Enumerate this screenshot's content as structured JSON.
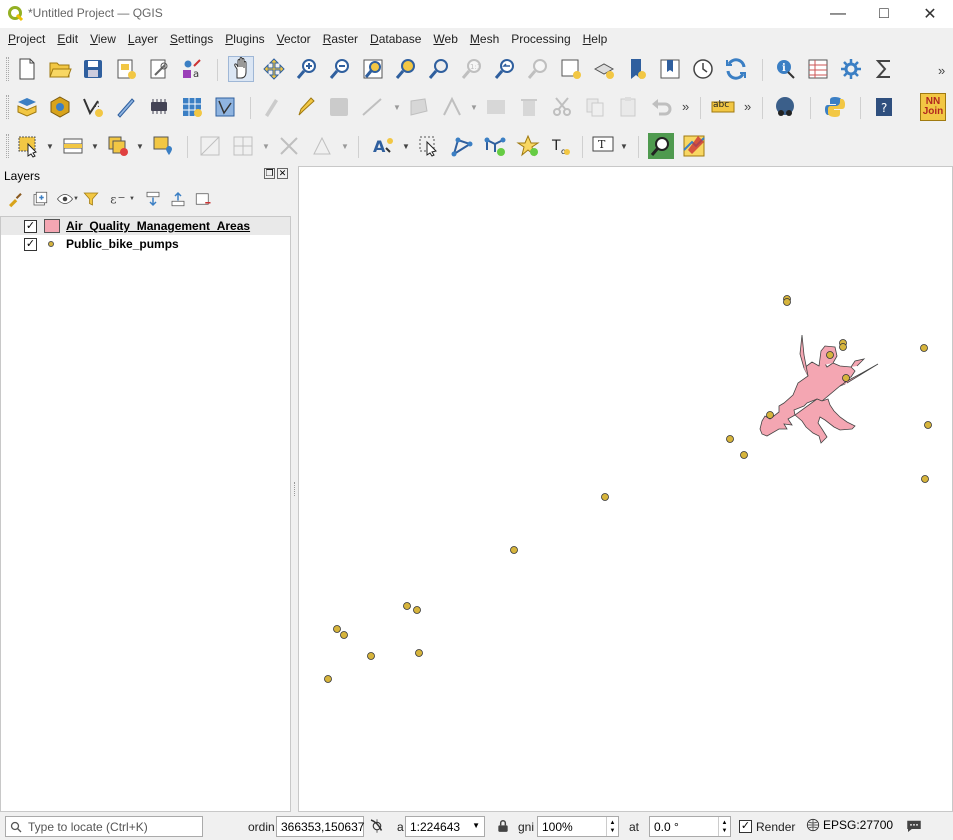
{
  "window": {
    "title": "*Untitled Project — QGIS"
  },
  "menu": [
    {
      "label": "Project",
      "key": "P",
      "rest": "roject"
    },
    {
      "label": "Edit",
      "key": "E",
      "rest": "dit"
    },
    {
      "label": "View",
      "key": "V",
      "rest": "iew"
    },
    {
      "label": "Layer",
      "key": "L",
      "rest": "ayer"
    },
    {
      "label": "Settings",
      "key": "S",
      "rest": "ettings"
    },
    {
      "label": "Plugins",
      "key": "P",
      "rest": "lugins"
    },
    {
      "label": "Vector",
      "key": "V",
      "rest": "ector"
    },
    {
      "label": "Raster",
      "key": "R",
      "rest": "aster"
    },
    {
      "label": "Database",
      "key": "D",
      "rest": "atabase"
    },
    {
      "label": "Web",
      "key": "W",
      "rest": "eb"
    },
    {
      "label": "Mesh",
      "key": "M",
      "rest": "esh"
    },
    {
      "label": "Processing",
      "key": "",
      "rest": "Processing"
    },
    {
      "label": "Help",
      "key": "H",
      "rest": "elp"
    }
  ],
  "toolbar": {
    "nn_join_line1": "NN",
    "nn_join_line2": "Join",
    "abc": "abc",
    "overflow": "»"
  },
  "layers_panel": {
    "title": "Layers",
    "layers": [
      {
        "name": "Air_Quality_Management_Areas",
        "checked": "✓",
        "type": "polygon",
        "color": "#f4a6b2"
      },
      {
        "name": "Public_bike_pumps",
        "checked": "✓",
        "type": "point",
        "color": "#d6b43c"
      }
    ]
  },
  "status": {
    "locate_placeholder": "Type to locate (Ctrl+K)",
    "coord_label": "ordin",
    "coordinate": "366353,150637",
    "scale_label": "a",
    "scale": "1:224643",
    "magnifier_label": "gni",
    "magnifier": "100%",
    "rotation_label": "at",
    "rotation": "0.0 °",
    "render_checked": "✓",
    "render_label": "Render",
    "crs": "EPSG:27700"
  },
  "map_data": {
    "polygon_color": "#f4a6b2",
    "point_color": "#d6b43c"
  }
}
